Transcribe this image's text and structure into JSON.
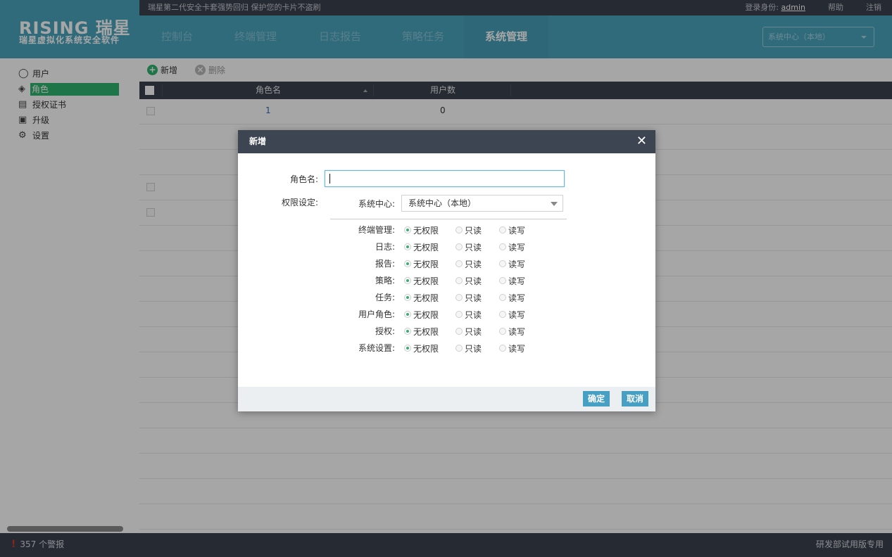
{
  "header": {
    "logo_main": "RISING 瑞星",
    "logo_sub": "瑞星虚拟化系统安全软件",
    "slogan": "瑞星第二代安全卡套强势回归 保护您的卡片不盗刷",
    "login_label": "登录身份:",
    "username": "admin",
    "help": "帮助",
    "logout": "注销",
    "nav": [
      {
        "label": "控制台"
      },
      {
        "label": "终端管理"
      },
      {
        "label": "日志报告"
      },
      {
        "label": "策略任务"
      },
      {
        "label": "系统管理"
      }
    ],
    "center_select": "系统中心（本地）"
  },
  "sidebar": {
    "items": [
      {
        "label": "用户",
        "icon": "user-icon"
      },
      {
        "label": "角色",
        "icon": "role-icon"
      },
      {
        "label": "授权证书",
        "icon": "certificate-icon"
      },
      {
        "label": "升级",
        "icon": "upgrade-icon"
      },
      {
        "label": "设置",
        "icon": "gear-icon"
      }
    ]
  },
  "toolbar": {
    "add_label": "新增",
    "delete_label": "删除"
  },
  "table": {
    "columns": [
      "角色名",
      "用户数"
    ],
    "rows": [
      {
        "name": "1",
        "users": "0"
      }
    ]
  },
  "status": {
    "alerts": "357 个警报",
    "edition": "研发部试用版专用"
  },
  "dialog": {
    "title": "新增",
    "role_name_label": "角色名:",
    "role_name_value": "",
    "perm_label": "权限设定:",
    "center_label": "系统中心:",
    "center_value": "系统中心（本地）",
    "options": [
      "无权限",
      "只读",
      "读写"
    ],
    "permissions": [
      {
        "label": "终端管理:",
        "selected": "无权限"
      },
      {
        "label": "日志:",
        "selected": "无权限"
      },
      {
        "label": "报告:",
        "selected": "无权限"
      },
      {
        "label": "策略:",
        "selected": "无权限"
      },
      {
        "label": "任务:",
        "selected": "无权限"
      },
      {
        "label": "用户角色:",
        "selected": "无权限"
      },
      {
        "label": "授权:",
        "selected": "无权限"
      },
      {
        "label": "系统设置:",
        "selected": "无权限"
      }
    ],
    "ok": "确定",
    "cancel": "取消"
  },
  "colors": {
    "brand": "#4aa5bf",
    "dark": "#3b414d",
    "accent_green": "#2fb46d"
  }
}
